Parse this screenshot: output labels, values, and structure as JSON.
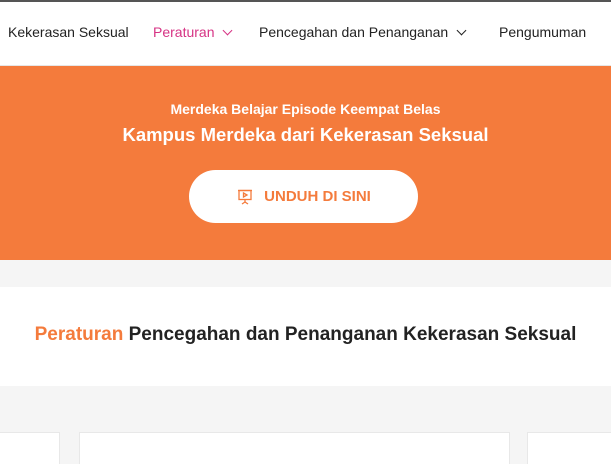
{
  "nav": {
    "items": [
      {
        "label": "Kekerasan Seksual",
        "has_dropdown": false,
        "active": false
      },
      {
        "label": "Peraturan",
        "has_dropdown": true,
        "active": true
      },
      {
        "label": "Pencegahan dan Penanganan",
        "has_dropdown": true,
        "active": false
      },
      {
        "label": "Pengumuman",
        "has_dropdown": false,
        "active": false
      }
    ]
  },
  "hero": {
    "subtitle": "Merdeka Belajar Episode Keempat Belas",
    "title": "Kampus Merdeka dari Kekerasan Seksual",
    "button_label": "UNDUH DI SINI",
    "button_icon": "presentation-icon"
  },
  "section": {
    "title_highlight": "Peraturan",
    "title_rest": " Pencegahan dan Penanganan Kekerasan Seksual"
  },
  "colors": {
    "accent": "#f47b3c",
    "nav_active": "#d63384",
    "text": "#222222",
    "background": "#f5f5f5"
  }
}
